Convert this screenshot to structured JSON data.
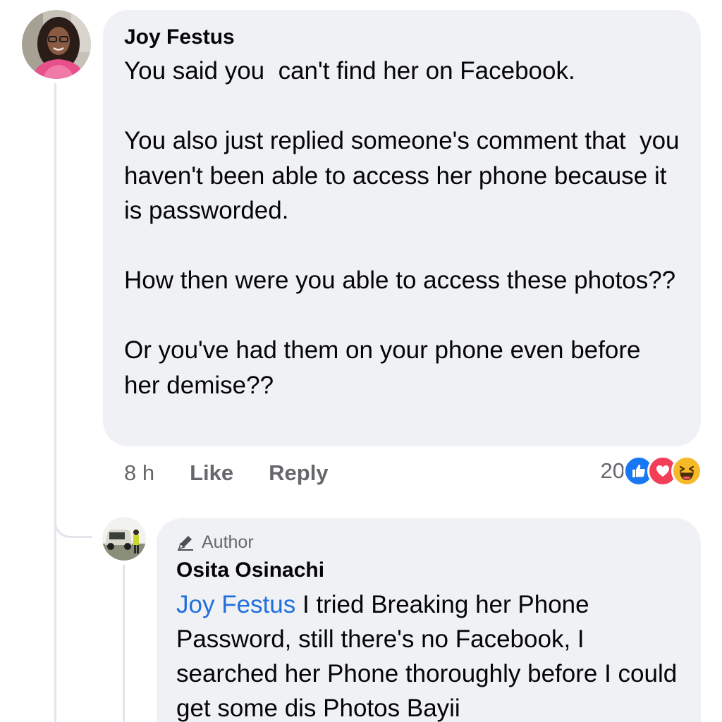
{
  "comment": {
    "author": "Joy Festus",
    "paragraphs": [
      "You said you  can't find her on Facebook.",
      "You also just replied someone's comment that  you haven't been able to access her phone because it is passworded.",
      "How then were you able to access these photos??",
      "Or you've had them on your phone even before her demise??"
    ],
    "timestamp": "8 h",
    "like_label": "Like",
    "reply_label": "Reply",
    "reaction_count": "20",
    "reactions": [
      "like-icon",
      "love-icon",
      "haha-icon"
    ]
  },
  "reply": {
    "badge_label": "Author",
    "author": "Osita Osinachi",
    "mention": "Joy Festus",
    "text": " I tried Breaking her Phone Password, still there's no Facebook, I searched her Phone thoroughly before I could get some dis Photos Bayii"
  },
  "colors": {
    "bubble": "#eff1f5",
    "mention": "#216fdb",
    "secondary_text": "#65676b",
    "like_blue": "#1877f2",
    "love_red": "#f33e58",
    "haha_yellow": "#f7b928"
  }
}
